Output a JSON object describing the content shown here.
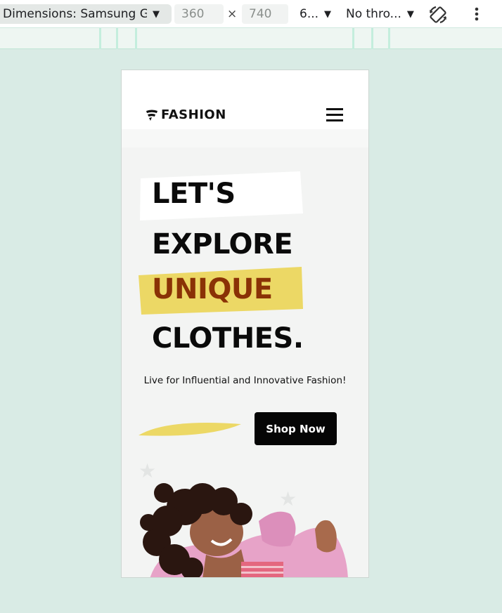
{
  "devtools": {
    "dimensions_label": "Dimensions: Samsung G...",
    "width_value": "360",
    "height_value": "740",
    "times_symbol": "×",
    "zoom_label": "6...",
    "throttle_label": "No thro...",
    "caret": "▼",
    "icons": [
      "caret-down-icon",
      "rotate-icon",
      "more-vertical-icon"
    ]
  },
  "site": {
    "logo_text": "FASHION",
    "hero": {
      "line1": "LET'S",
      "line2": "EXPLORE",
      "line3": "UNIQUE",
      "line4": "CLOTHES."
    },
    "tagline": "Live for Influential and Innovative Fashion!",
    "shop_button": "Shop Now",
    "star_glyph": "★",
    "colors": {
      "accent_yellow": "#ecd865",
      "unique_text": "#8a3206",
      "button_bg": "#050505"
    }
  }
}
